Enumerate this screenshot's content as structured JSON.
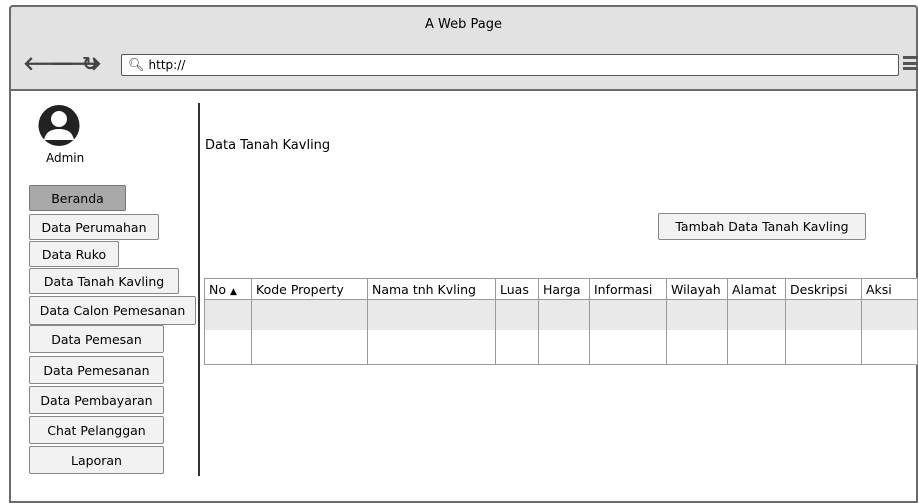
{
  "window": {
    "title": "A Web Page"
  },
  "browser": {
    "url": "http://",
    "back_icon": "arrow-left-icon",
    "forward_icon": "arrow-right-icon",
    "reload_icon": "reload-icon",
    "menu_icon": "hamburger-icon"
  },
  "sidebar": {
    "user_label": "Admin",
    "items": [
      {
        "label": "Beranda"
      },
      {
        "label": "Data Perumahan"
      },
      {
        "label": "Data Ruko"
      },
      {
        "label": "Data Tanah Kavling"
      },
      {
        "label": "Data Calon Pemesanan"
      },
      {
        "label": "Data Pemesan"
      },
      {
        "label": "Data Pemesanan"
      },
      {
        "label": "Data Pembayaran"
      },
      {
        "label": "Chat Pelanggan"
      },
      {
        "label": "Laporan"
      }
    ]
  },
  "main": {
    "title": "Data Tanah Kavling",
    "add_button": "Tambah Data Tanah Kavling",
    "table": {
      "columns": [
        "No",
        "Kode Property",
        "Nama tnh Kvling",
        "Luas",
        "Harga",
        "Informasi",
        "Wilayah",
        "Alamat",
        "Deskripsi",
        "Aksi"
      ],
      "sort_indicator": "▲",
      "rows": [
        [
          "",
          "",
          "",
          "",
          "",
          "",
          "",
          "",
          "",
          ""
        ],
        [
          "",
          "",
          "",
          "",
          "",
          "",
          "",
          "",
          "",
          ""
        ]
      ]
    }
  }
}
